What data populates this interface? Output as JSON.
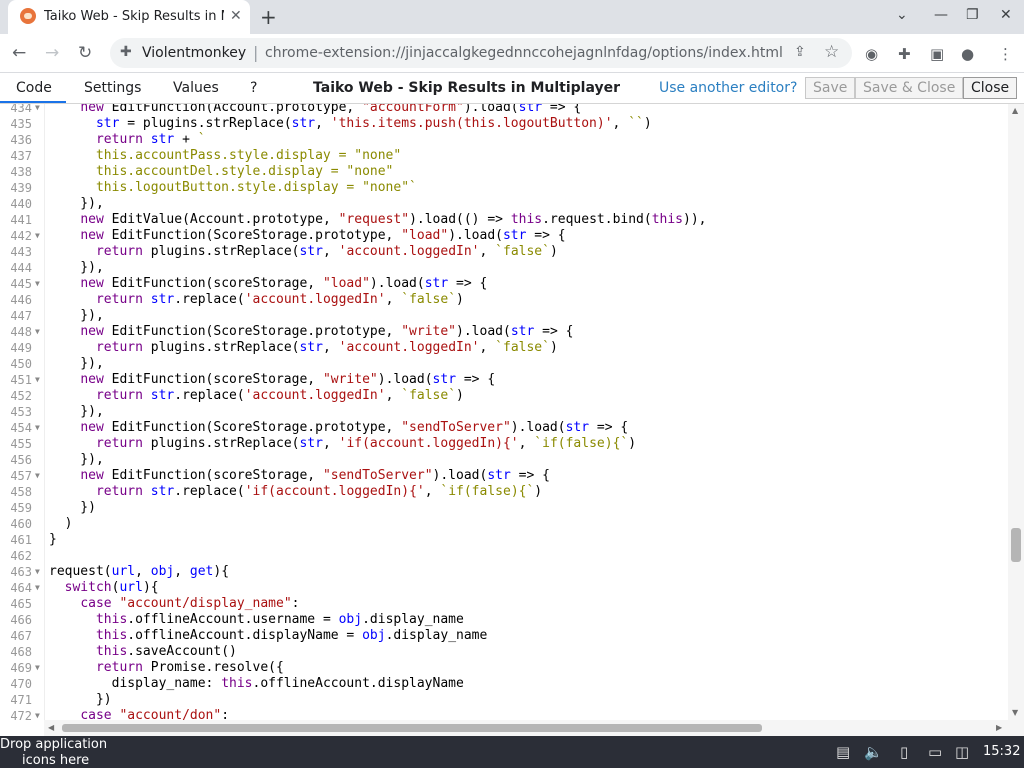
{
  "browser": {
    "tab_title": "Taiko Web - Skip Results in Multiplayer",
    "tab_close": "✕",
    "new_tab": "+",
    "site_name": "Violentmonkey",
    "url": "chrome-extension://jinjaccalgkegednnccohejagnlnfdag/options/index.html"
  },
  "editor": {
    "tabs": [
      "Code",
      "Settings",
      "Values",
      "?"
    ],
    "title": "Taiko Web - Skip Results in Multiplayer",
    "another_editor": "Use another editor?",
    "save": "Save",
    "save_close": "Save & Close",
    "close": "Close"
  },
  "code_lines": [
    {
      "n": "434",
      "fold": true,
      "t": "    new EditFunction(Account.prototype, \"accountForm\").load(str => {"
    },
    {
      "n": "435",
      "fold": false,
      "t": "      str = plugins.strReplace(str, 'this.items.push(this.logoutButton)', ``)"
    },
    {
      "n": "436",
      "fold": false,
      "t": "      return str + `"
    },
    {
      "n": "437",
      "fold": false,
      "t": "      this.accountPass.style.display = \"none\""
    },
    {
      "n": "438",
      "fold": false,
      "t": "      this.accountDel.style.display = \"none\""
    },
    {
      "n": "439",
      "fold": false,
      "t": "      this.logoutButton.style.display = \"none\"`"
    },
    {
      "n": "440",
      "fold": false,
      "t": "    }),"
    },
    {
      "n": "441",
      "fold": false,
      "t": "    new EditValue(Account.prototype, \"request\").load(() => this.request.bind(this)),"
    },
    {
      "n": "442",
      "fold": true,
      "t": "    new EditFunction(ScoreStorage.prototype, \"load\").load(str => {"
    },
    {
      "n": "443",
      "fold": false,
      "t": "      return plugins.strReplace(str, 'account.loggedIn', `false`)"
    },
    {
      "n": "444",
      "fold": false,
      "t": "    }),"
    },
    {
      "n": "445",
      "fold": true,
      "t": "    new EditFunction(scoreStorage, \"load\").load(str => {"
    },
    {
      "n": "446",
      "fold": false,
      "t": "      return str.replace('account.loggedIn', `false`)"
    },
    {
      "n": "447",
      "fold": false,
      "t": "    }),"
    },
    {
      "n": "448",
      "fold": true,
      "t": "    new EditFunction(ScoreStorage.prototype, \"write\").load(str => {"
    },
    {
      "n": "449",
      "fold": false,
      "t": "      return plugins.strReplace(str, 'account.loggedIn', `false`)"
    },
    {
      "n": "450",
      "fold": false,
      "t": "    }),"
    },
    {
      "n": "451",
      "fold": true,
      "t": "    new EditFunction(scoreStorage, \"write\").load(str => {"
    },
    {
      "n": "452",
      "fold": false,
      "t": "      return str.replace('account.loggedIn', `false`)"
    },
    {
      "n": "453",
      "fold": false,
      "t": "    }),"
    },
    {
      "n": "454",
      "fold": true,
      "t": "    new EditFunction(ScoreStorage.prototype, \"sendToServer\").load(str => {"
    },
    {
      "n": "455",
      "fold": false,
      "t": "      return plugins.strReplace(str, 'if(account.loggedIn){', `if(false){`)"
    },
    {
      "n": "456",
      "fold": false,
      "t": "    }),"
    },
    {
      "n": "457",
      "fold": true,
      "t": "    new EditFunction(scoreStorage, \"sendToServer\").load(str => {"
    },
    {
      "n": "458",
      "fold": false,
      "t": "      return str.replace('if(account.loggedIn){', `if(false){`)"
    },
    {
      "n": "459",
      "fold": false,
      "t": "    })"
    },
    {
      "n": "460",
      "fold": false,
      "t": "  )"
    },
    {
      "n": "461",
      "fold": false,
      "t": "}"
    },
    {
      "n": "462",
      "fold": false,
      "t": ""
    },
    {
      "n": "463",
      "fold": true,
      "t": "request(url, obj, get){"
    },
    {
      "n": "464",
      "fold": true,
      "t": "  switch(url){"
    },
    {
      "n": "465",
      "fold": false,
      "t": "    case \"account/display_name\":"
    },
    {
      "n": "466",
      "fold": false,
      "t": "      this.offlineAccount.username = obj.display_name"
    },
    {
      "n": "467",
      "fold": false,
      "t": "      this.offlineAccount.displayName = obj.display_name"
    },
    {
      "n": "468",
      "fold": false,
      "t": "      this.saveAccount()"
    },
    {
      "n": "469",
      "fold": true,
      "t": "      return Promise.resolve({"
    },
    {
      "n": "470",
      "fold": false,
      "t": "        display_name: this.offlineAccount.displayName"
    },
    {
      "n": "471",
      "fold": false,
      "t": "      })"
    },
    {
      "n": "472",
      "fold": true,
      "t": "    case \"account/don\":"
    }
  ],
  "taskbar": {
    "drop_line1": "Drop application",
    "drop_line2": "icons here",
    "clock": "15:32"
  },
  "colors": {
    "keyword": "#770088",
    "variable": "#0000ff",
    "string": "#aa1111",
    "template": "#8a8a00",
    "accent": "#1a73e8",
    "link": "#2b7fc1"
  },
  "icons": {
    "favicon": "monkey-icon",
    "back": "←",
    "forward": "→",
    "reload": "↻",
    "share": "⇪",
    "star": "☆",
    "minimize": "—",
    "maximize": "❐",
    "close": "✕",
    "chevron": "⌄",
    "volume": "🔈"
  }
}
